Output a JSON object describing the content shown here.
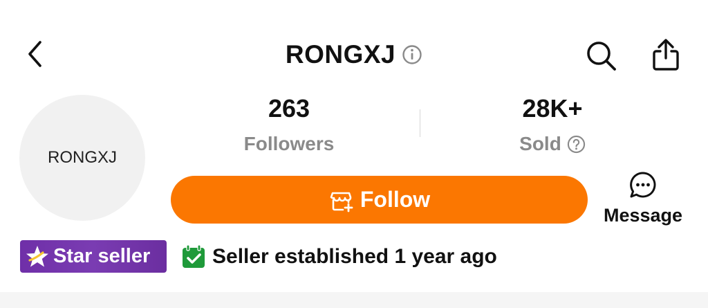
{
  "header": {
    "title": "RONGXJ",
    "back_icon": "chevron-left-icon",
    "info_icon": "info-icon",
    "search_icon": "search-icon",
    "share_icon": "share-icon"
  },
  "avatar": {
    "text": "RONGXJ"
  },
  "stats": {
    "followers": {
      "value": "263",
      "label": "Followers"
    },
    "sold": {
      "value": "28K+",
      "label": "Sold",
      "help_icon": "question-circle-icon"
    }
  },
  "actions": {
    "follow_label": "Follow",
    "follow_icon": "store-plus-icon",
    "message_label": "Message",
    "message_icon": "chat-bubble-icon"
  },
  "badges": {
    "star_seller": "Star seller",
    "star_icon": "star-icon",
    "established": "Seller established 1 year ago",
    "established_icon": "calendar-check-icon"
  },
  "colors": {
    "accent_orange": "#fb7701",
    "star_badge_purple": "#6f2fa8",
    "calendar_green": "#1f9a3a",
    "muted_gray": "#8a8a8a"
  }
}
